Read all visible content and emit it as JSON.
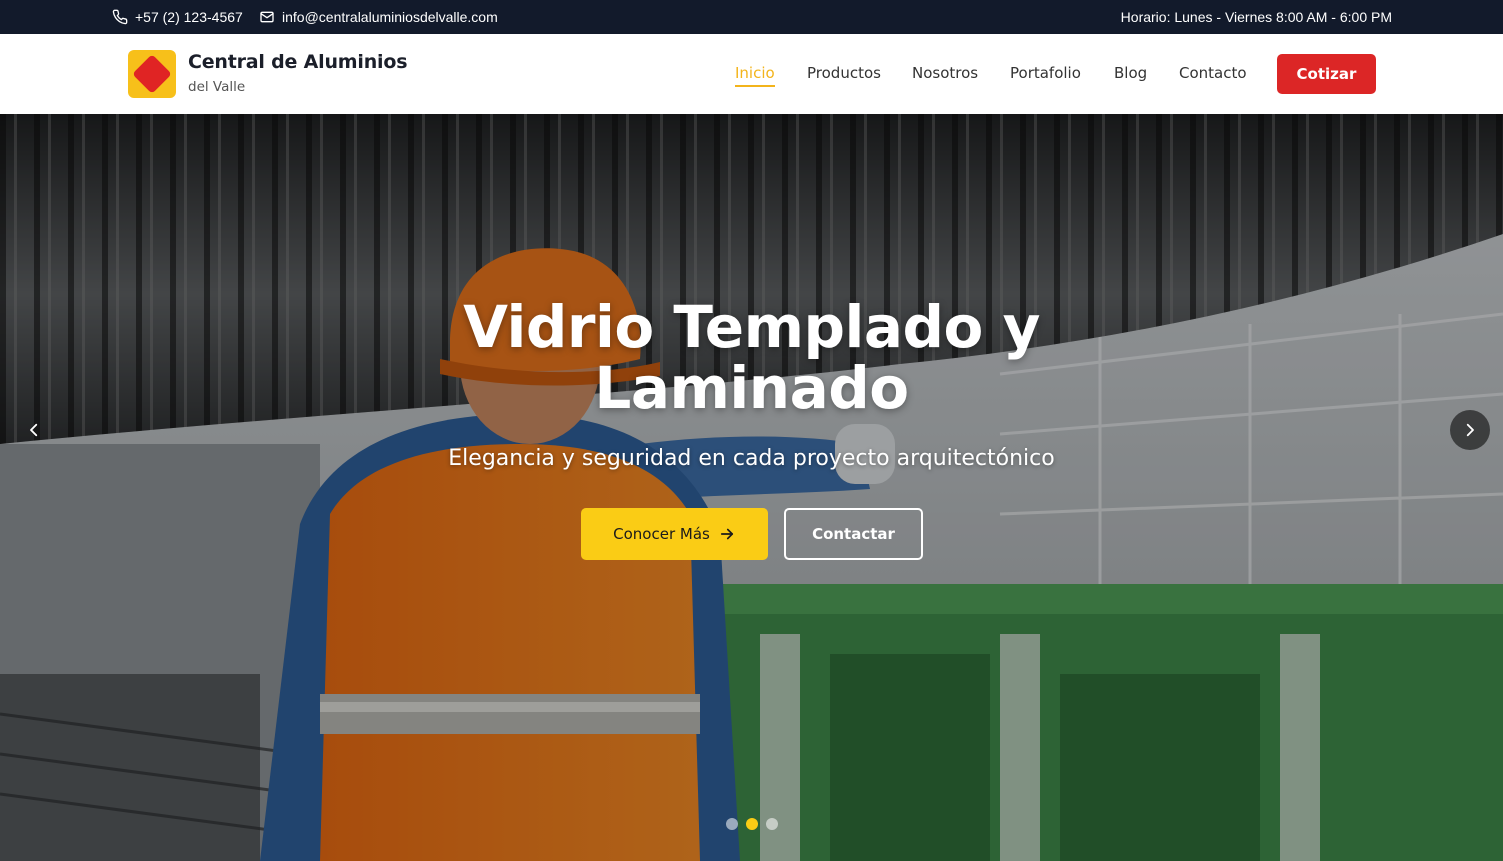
{
  "topbar": {
    "phone": "+57 (2) 123-4567",
    "email": "info@centralaluminiosdelvalle.com",
    "hours": "Horario: Lunes - Viernes 8:00 AM - 6:00 PM",
    "phone_icon": "phone-icon",
    "email_icon": "mail-icon"
  },
  "brand": {
    "name": "Central de Aluminios",
    "sub": "del Valle",
    "logo_colors": {
      "box": "#f7c01a",
      "diamond": "#e02424"
    }
  },
  "nav": {
    "items": [
      {
        "label": "Inicio",
        "active": true
      },
      {
        "label": "Productos",
        "active": false
      },
      {
        "label": "Nosotros",
        "active": false
      },
      {
        "label": "Portafolio",
        "active": false
      },
      {
        "label": "Blog",
        "active": false
      },
      {
        "label": "Contacto",
        "active": false
      }
    ],
    "cta": "Cotizar"
  },
  "hero": {
    "title_line1": "Vidrio Templado y",
    "title_line2": "Laminado",
    "subtitle": "Elegancia y seguridad en cada proyecto arquitectónico",
    "primary_button": "Conocer Más",
    "secondary_button": "Contactar",
    "slides": 3,
    "active_slide": 2
  },
  "colors": {
    "topbar_bg": "#121a2b",
    "accent_yellow": "#facc15",
    "accent_red": "#dc2626",
    "nav_active": "#f3b41b"
  }
}
